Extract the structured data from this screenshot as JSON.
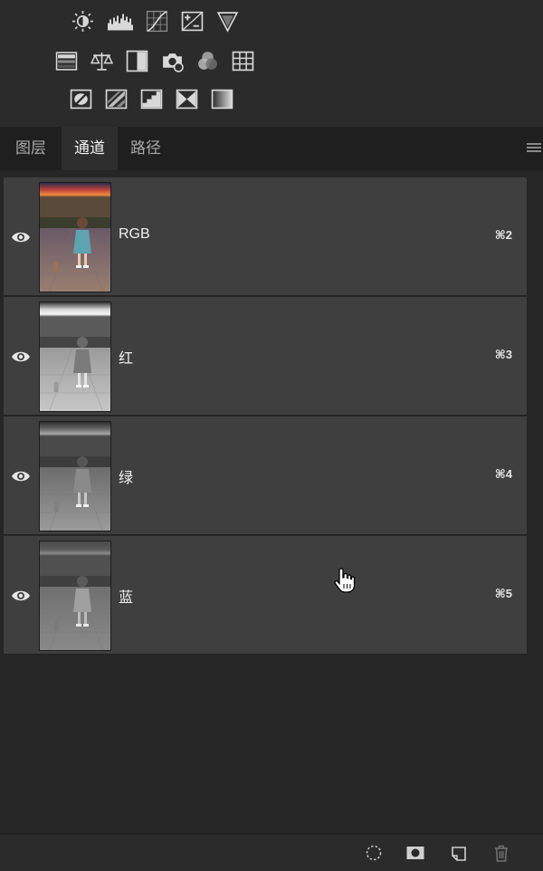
{
  "adjustments": {
    "row1": [
      "brightness-contrast-icon",
      "levels-icon",
      "curves-icon",
      "exposure-icon",
      "vibrance-icon"
    ],
    "row2": [
      "hue-saturation-icon",
      "color-balance-icon",
      "black-white-icon",
      "photo-filter-icon",
      "channel-mixer-icon",
      "color-lookup-icon"
    ],
    "row3": [
      "invert-icon",
      "posterize-icon",
      "threshold-icon",
      "selective-color-icon",
      "gradient-map-icon"
    ]
  },
  "tabs": [
    {
      "label": "图层",
      "active": false
    },
    {
      "label": "通道",
      "active": true
    },
    {
      "label": "路径",
      "active": false
    }
  ],
  "channels": [
    {
      "name": "RGB",
      "shortcut": "⌘2",
      "thumb": "color"
    },
    {
      "name": "红",
      "shortcut": "⌘3",
      "thumb": "red"
    },
    {
      "name": "绿",
      "shortcut": "⌘4",
      "thumb": "green"
    },
    {
      "name": "蓝",
      "shortcut": "⌘5",
      "thumb": "blue"
    }
  ],
  "bottom_actions": [
    "load-selection-icon",
    "save-selection-mask-icon",
    "new-channel-icon",
    "delete-channel-icon"
  ],
  "colors": {
    "panel_bg": "#2b2b2b",
    "row_bg": "#3f3f3f",
    "tab_active_bg": "#2e2e2e",
    "text": "#f0f0f0"
  }
}
